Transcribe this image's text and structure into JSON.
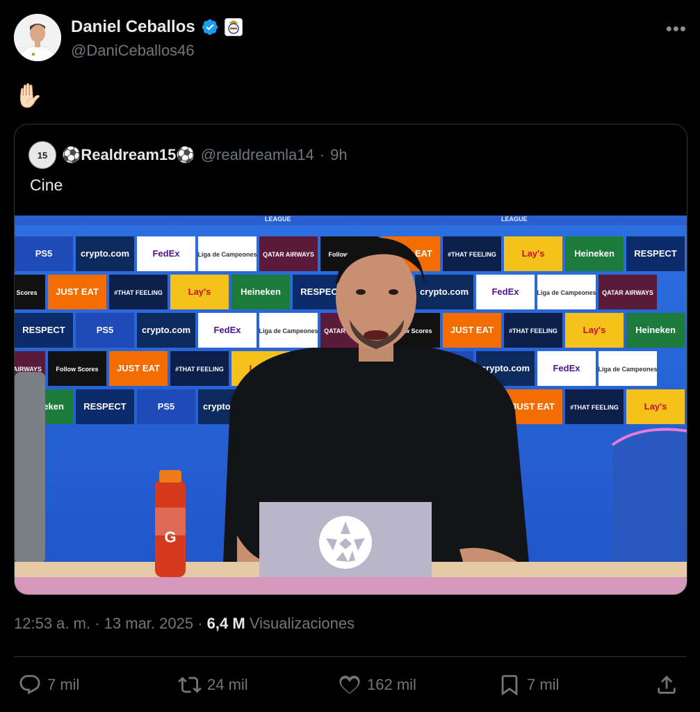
{
  "author": {
    "name": "Daniel Ceballos",
    "handle": "@DaniCeballos46",
    "verified_color": "#1d9bf0"
  },
  "tweet": {
    "text": "✋🏻"
  },
  "quoted": {
    "avatar_text": "15",
    "name": "⚽Realdream15⚽",
    "handle": "@realdreamla14",
    "separator": "·",
    "time": "9h",
    "text": "Cine",
    "media": {
      "sponsor_boards": [
        "PS5",
        "QATAR AIRWAYS",
        "Lay's",
        "crypto.com",
        "Follow Scores",
        "Heineken",
        "FedEx",
        "JUST EAT",
        "RESPECT",
        "Liga de Campeones",
        "#THAT FEELING"
      ],
      "board_top_label": "LEAGUE"
    }
  },
  "meta": {
    "time": "12:53 a. m.",
    "sep1": "·",
    "date": "13 mar. 2025",
    "sep2": "·",
    "views_count": "6,4 M",
    "views_label": "Visualizaciones"
  },
  "actions": {
    "replies": "7 mil",
    "reposts": "24 mil",
    "likes": "162 mil",
    "bookmarks": "7 mil"
  },
  "icons": [
    "verified-icon",
    "real-madrid-badge-icon",
    "more-icon",
    "reply-icon",
    "repost-icon",
    "like-icon",
    "bookmark-icon",
    "share-icon",
    "soccer-ball-icon",
    "champions-league-starball-icon"
  ]
}
